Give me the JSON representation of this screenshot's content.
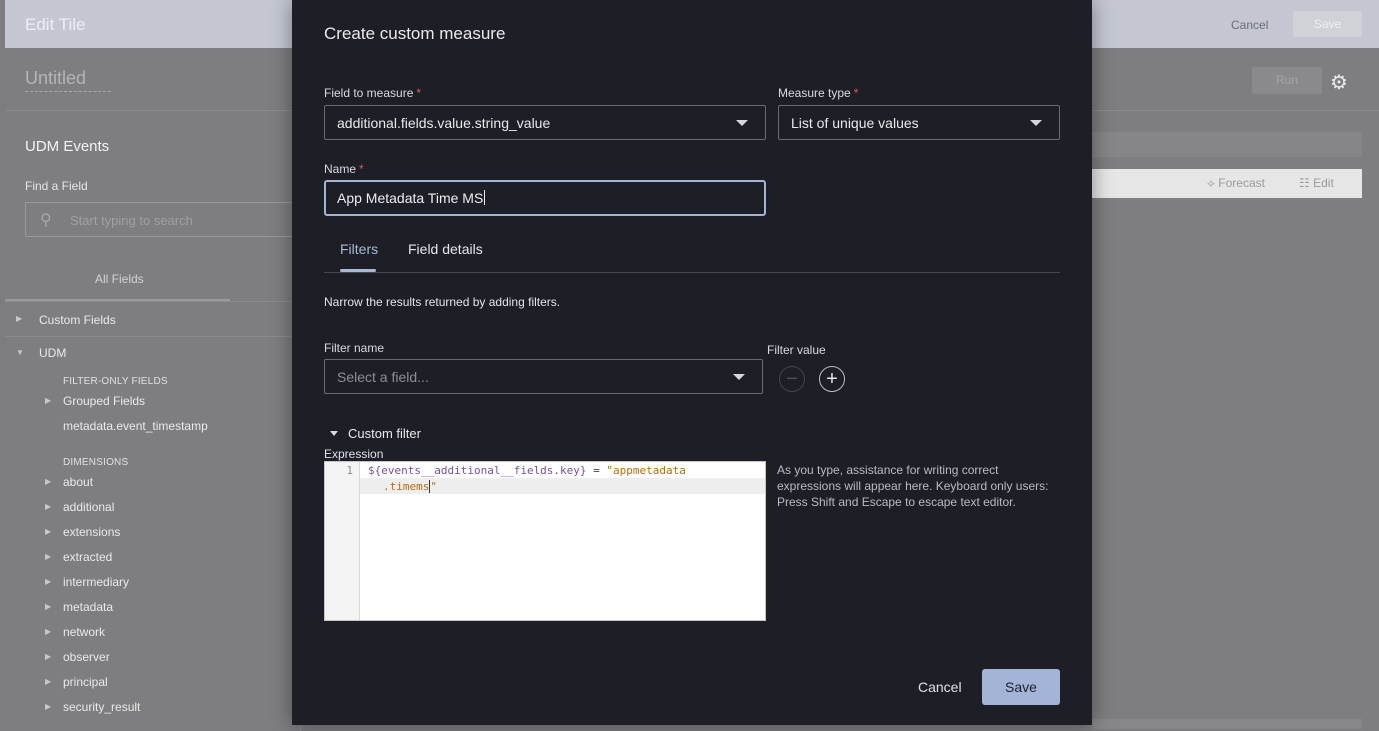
{
  "background_app": {
    "title": "Edit Tile",
    "cancel_label": "Cancel",
    "save_label": "Save",
    "tile_name": "Untitled",
    "run_label": "Run",
    "sidebar": {
      "heading": "UDM Events",
      "find_label": "Find a Field",
      "search_placeholder": "Start typing to search",
      "tab_label": "All Fields",
      "groups": [
        {
          "label": "Custom Fields",
          "expanded": false
        },
        {
          "label": "UDM",
          "expanded": true
        }
      ],
      "filter_only_heading": "FILTER-ONLY FIELDS",
      "filter_only_items": [
        "Grouped Fields",
        "metadata.event_timestamp"
      ],
      "dimensions_heading": "DIMENSIONS",
      "dimensions": [
        "about",
        "additional",
        "extensions",
        "extracted",
        "intermediary",
        "metadata",
        "network",
        "observer",
        "principal",
        "security_result"
      ]
    },
    "toolbar": {
      "forecast_label": "Forecast",
      "edit_label": "Edit"
    }
  },
  "modal": {
    "title": "Create custom measure",
    "field_to_measure": {
      "label": "Field to measure",
      "required_mark": "*",
      "value": "additional.fields.value.string_value"
    },
    "measure_type": {
      "label": "Measure type",
      "required_mark": "*",
      "value": "List of unique values"
    },
    "name": {
      "label": "Name",
      "required_mark": "*",
      "value": "App Metadata Time MS"
    },
    "tabs": [
      {
        "label": "Filters",
        "active": true
      },
      {
        "label": "Field details",
        "active": false
      }
    ],
    "filters_description": "Narrow the results returned by adding filters.",
    "filter_name": {
      "label": "Filter name",
      "placeholder": "Select a field..."
    },
    "filter_value_label": "Filter value",
    "custom_filter": {
      "label": "Custom filter",
      "expression_label": "Expression",
      "line_number": "1",
      "code_variable": "${events__additional__fields.key}",
      "code_operator": " = ",
      "code_string_part1": "\"appmetadata",
      "code_string_part2": ".timems",
      "code_string_end": "\"",
      "hint": "As you type, assistance for writing correct expressions will appear here. Keyboard only users: Press Shift and Escape to escape text editor."
    },
    "cancel_label": "Cancel",
    "save_label": "Save"
  },
  "colors": {
    "modal_bg": "#1e1f26",
    "accent": "#a4b4d6",
    "required": "#e05a5a",
    "overlay": "#7e7e80"
  }
}
